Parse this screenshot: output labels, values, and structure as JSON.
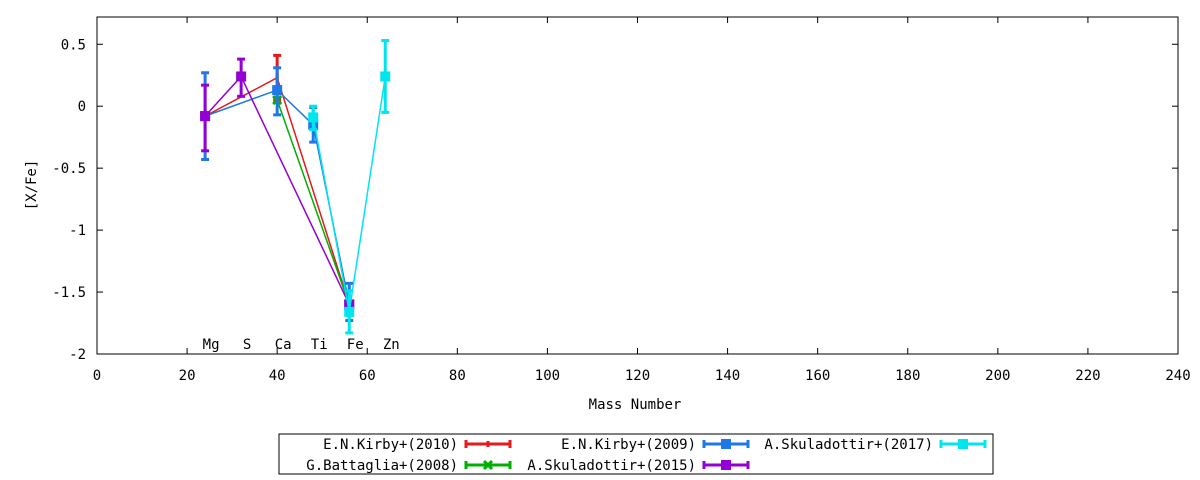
{
  "chart_data": {
    "type": "scatter",
    "title": "",
    "xlabel": "Mass Number",
    "ylabel": "[X/Fe]",
    "xlim": [
      0,
      240
    ],
    "ylim": [
      -2,
      0.72
    ],
    "x_ticks": [
      0,
      20,
      40,
      60,
      80,
      100,
      120,
      140,
      160,
      180,
      200,
      220,
      240
    ],
    "y_ticks": [
      0.5,
      0,
      -0.5,
      -1,
      -1.5,
      -2
    ],
    "x_tick_labels": [
      "0",
      "20",
      "40",
      "60",
      "80",
      "100",
      "120",
      "140",
      "160",
      "180",
      "200",
      "220",
      "240"
    ],
    "y_tick_labels": [
      "0.5",
      "0",
      "-0.5",
      "-1",
      "-1.5",
      "-2"
    ],
    "grid": false,
    "legend_position": "bottom",
    "element_labels": [
      {
        "text": "Mg",
        "x": 24
      },
      {
        "text": "S",
        "x": 32
      },
      {
        "text": "Ca",
        "x": 40
      },
      {
        "text": "Ti",
        "x": 48
      },
      {
        "text": "Fe",
        "x": 56
      },
      {
        "text": "Zn",
        "x": 64
      }
    ],
    "series": [
      {
        "name": "E.N.Kirby+(2010)",
        "color": "#e41a1c",
        "marker": "bar",
        "points": [
          {
            "x": 24,
            "y": -0.08,
            "lo": -0.08,
            "hi": -0.08
          },
          {
            "x": 40,
            "y": 0.23,
            "lo": 0.05,
            "hi": 0.41
          },
          {
            "x": 56,
            "y": -1.6,
            "lo": -1.6,
            "hi": -1.6
          }
        ]
      },
      {
        "name": "G.Battaglia+(2008)",
        "color": "#00b000",
        "marker": "cross",
        "points": [
          {
            "x": 40,
            "y": 0.05,
            "lo": 0.05,
            "hi": 0.05
          },
          {
            "x": 56,
            "y": -1.6,
            "lo": -1.6,
            "hi": -1.6
          }
        ]
      },
      {
        "name": "E.N.Kirby+(2009)",
        "color": "#1e78e6",
        "marker": "square",
        "points": [
          {
            "x": 24,
            "y": -0.08,
            "lo": -0.43,
            "hi": 0.27
          },
          {
            "x": 40,
            "y": 0.13,
            "lo": -0.07,
            "hi": 0.31
          },
          {
            "x": 48,
            "y": -0.15,
            "lo": -0.29,
            "hi": -0.01
          },
          {
            "x": 56,
            "y": -1.6,
            "lo": -1.73,
            "hi": -1.43
          }
        ]
      },
      {
        "name": "A.Skuladottir+(2015)",
        "color": "#9400d3",
        "marker": "square",
        "points": [
          {
            "x": 24,
            "y": -0.08,
            "lo": -0.36,
            "hi": 0.17
          },
          {
            "x": 32,
            "y": 0.24,
            "lo": 0.08,
            "hi": 0.38
          },
          {
            "x": 56,
            "y": -1.6,
            "lo": -1.6,
            "hi": -1.6
          }
        ]
      },
      {
        "name": "A.Skuladottir+(2017)",
        "color": "#00e5ee",
        "marker": "square",
        "points": [
          {
            "x": 48,
            "y": -0.09,
            "lo": -0.19,
            "hi": 0.0
          },
          {
            "x": 56,
            "y": -1.66,
            "lo": -1.83,
            "hi": -1.49
          },
          {
            "x": 64,
            "y": 0.24,
            "lo": -0.05,
            "hi": 0.53
          }
        ]
      }
    ]
  }
}
